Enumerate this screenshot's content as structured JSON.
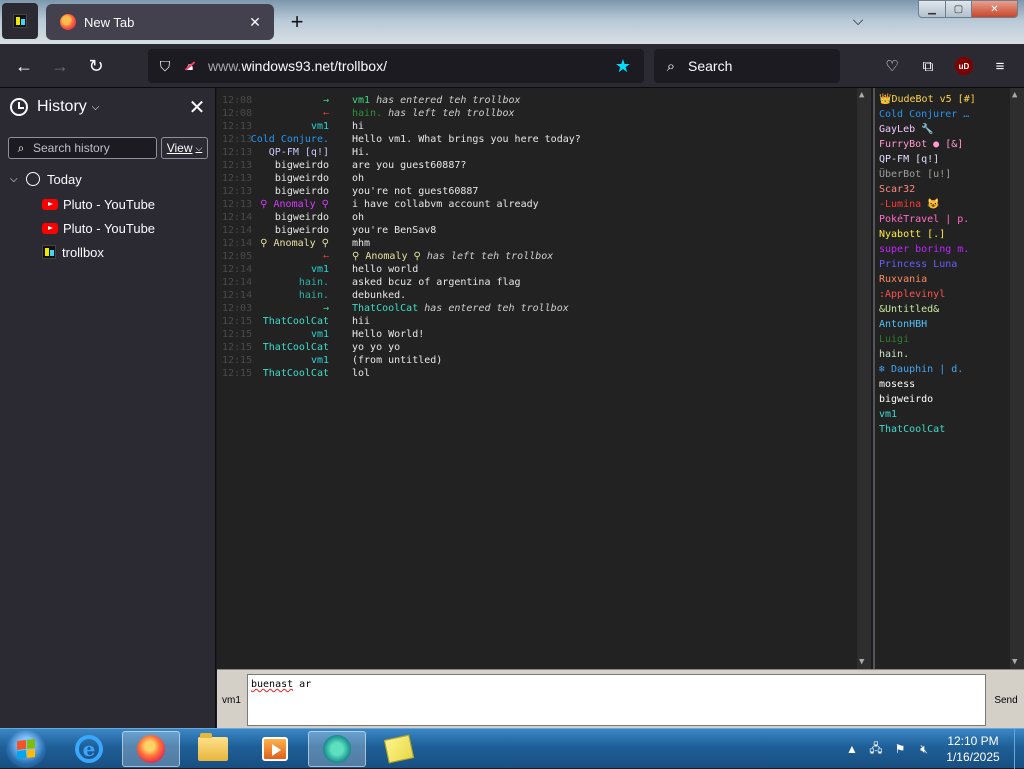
{
  "browser": {
    "tab_title": "New Tab",
    "tab_close": "✕",
    "new_tab": "+",
    "tab_list": "⌵",
    "url_prefix": "www.",
    "url_main": "windows93.net/trollbox/",
    "search_placeholder": "Search",
    "ubo_badge": "uD"
  },
  "sidebar": {
    "title": "History",
    "search_placeholder": "Search history",
    "view_label": "View",
    "group": "Today",
    "items": [
      {
        "label": "Pluto - YouTube"
      },
      {
        "label": "Pluto - YouTube"
      },
      {
        "label": "trollbox"
      }
    ]
  },
  "chat": {
    "messages": [
      {
        "time": "12:08",
        "nick": "→",
        "nick_color": "#3ddc84",
        "text": "vm1",
        "text_color": "#3ddc84",
        "rest": " has entered teh trollbox",
        "system": true
      },
      {
        "time": "12:08",
        "nick": "←",
        "nick_color": "#e53935",
        "text": "hain.",
        "text_color": "#2f8f3a",
        "rest": " has left teh trollbox",
        "system": true
      },
      {
        "time": "12:13",
        "nick": "vm1",
        "nick_color": "#2ad4d4",
        "text": "hi",
        "system": false
      },
      {
        "time": "12:13",
        "nick": "Cold Conjure.",
        "nick_color": "#2196f3",
        "text": "Hello vm1. What brings you here today?",
        "system": false
      },
      {
        "time": "12:13",
        "nick": "QP-FM [q!]",
        "nick_color": "#c8c8ff",
        "text": "Hi.",
        "system": false
      },
      {
        "time": "12:13",
        "nick": "bigweirdo",
        "nick_color": "#e8e8e8",
        "text": "are you guest60887?",
        "system": false
      },
      {
        "time": "12:13",
        "nick": "bigweirdo",
        "nick_color": "#e8e8e8",
        "text": "oh",
        "system": false
      },
      {
        "time": "12:13",
        "nick": "bigweirdo",
        "nick_color": "#e8e8e8",
        "text": "you're not guest60887",
        "system": false
      },
      {
        "time": "12:13",
        "nick": "⚲ Anomaly ⚲",
        "nick_color": "#d83bff",
        "text": "i have collabvm account already",
        "system": false
      },
      {
        "time": "12:14",
        "nick": "bigweirdo",
        "nick_color": "#e8e8e8",
        "text": "oh",
        "system": false
      },
      {
        "time": "12:14",
        "nick": "bigweirdo",
        "nick_color": "#e8e8e8",
        "text": "you're BenSav8",
        "system": false
      },
      {
        "time": "12:14",
        "nick": "⚲ Anomaly ⚲",
        "nick_color": "#e8e0a0",
        "text": "mhm",
        "system": false
      },
      {
        "time": "12:05",
        "nick": "←",
        "nick_color": "#e53935",
        "text": "⚲ Anomaly ⚲",
        "text_color": "#e8e0a0",
        "rest": " has left teh trollbox",
        "system": true
      },
      {
        "time": "12:14",
        "nick": "vm1",
        "nick_color": "#2ad4d4",
        "text": "hello world",
        "system": false
      },
      {
        "time": "12:14",
        "nick": "hain.",
        "nick_color": "#2bb3a8",
        "text": "asked bcuz of argentina flag",
        "system": false
      },
      {
        "time": "12:14",
        "nick": "hain.",
        "nick_color": "#2bb3a8",
        "text": "debunked.",
        "system": false
      },
      {
        "time": "12:03",
        "nick": "→",
        "nick_color": "#3ddc84",
        "text": "ThatCoolCat",
        "text_color": "#3ddcc8",
        "rest": " has entered teh trollbox",
        "system": true
      },
      {
        "time": "12:15",
        "nick": "ThatCoolCat",
        "nick_color": "#3ddcc8",
        "text": "hii",
        "system": false
      },
      {
        "time": "12:15",
        "nick": "vm1",
        "nick_color": "#2ad4d4",
        "text": "Hello World!",
        "system": false
      },
      {
        "time": "12:15",
        "nick": "ThatCoolCat",
        "nick_color": "#3ddcc8",
        "text": "yo yo yo",
        "system": false
      },
      {
        "time": "12:15",
        "nick": "vm1",
        "nick_color": "#2ad4d4",
        "text": "(from untitled)",
        "system": false
      },
      {
        "time": "12:15",
        "nick": "ThatCoolCat",
        "nick_color": "#3ddcc8",
        "text": "lol",
        "system": false
      }
    ]
  },
  "users": [
    {
      "name": "👑DudeBot v5 [#]",
      "color": "#ffd54a"
    },
    {
      "name": "Cold Conjurer …",
      "color": "#2196f3"
    },
    {
      "name": "GayLeb 🔧",
      "color": "#f0c8ff"
    },
    {
      "name": "FurryBot ● [&]",
      "color": "#ff9ad0"
    },
    {
      "name": "QP-FM [q!]",
      "color": "#e0e0ff"
    },
    {
      "name": "ÜberBot [u!]",
      "color": "#9e9e9e"
    },
    {
      "name": "Scar32",
      "color": "#ff8a80"
    },
    {
      "name": "-Lumina 😺",
      "color": "#ff3b30"
    },
    {
      "name": "PokéTravel | p.",
      "color": "#ff6ec7"
    },
    {
      "name": "Nyabott [.]",
      "color": "#ffeb3b"
    },
    {
      "name": "super boring m.",
      "color": "#c026ff"
    },
    {
      "name": "Princess Luna",
      "color": "#6a5cff"
    },
    {
      "name": "Ruxvania",
      "color": "#ff8a65"
    },
    {
      "name": ":Applevinyl",
      "color": "#ff5252"
    },
    {
      "name": "&Untitled&",
      "color": "#c8e6a0"
    },
    {
      "name": "AntonHBH",
      "color": "#4fc3f7"
    },
    {
      "name": "Luigi",
      "color": "#2e7d32"
    },
    {
      "name": "hain.",
      "color": "#c8e6c9"
    },
    {
      "name": "❄ Dauphin | d.",
      "color": "#42a5f5"
    },
    {
      "name": "mosess",
      "color": "#ffffff"
    },
    {
      "name": "bigweirdo",
      "color": "#ffffff"
    },
    {
      "name": "vm1",
      "color": "#3ddcc8"
    },
    {
      "name": "ThatCoolCat",
      "color": "#3ddcc8"
    }
  ],
  "input": {
    "nick": "vm1",
    "value_word": "buenast",
    "value_rest": " ar",
    "send_label": "Send"
  },
  "taskbar": {
    "time": "12:10 PM",
    "date": "1/16/2025"
  }
}
